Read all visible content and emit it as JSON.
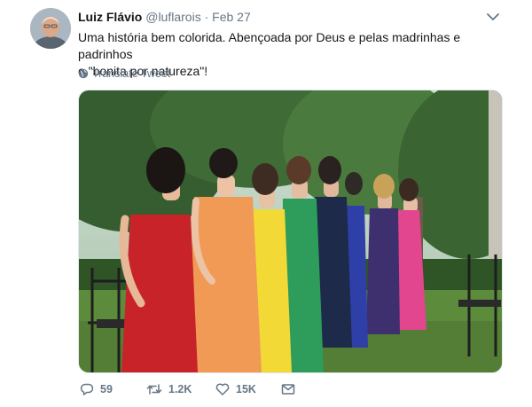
{
  "tweet": {
    "author_name": "Luiz Flávio",
    "handle": "@luflarois",
    "separator": "·",
    "date": "Feb 27",
    "text_line1": "Uma história bem colorida. Abençoada por Deus e pelas madrinhas e padrinhos",
    "text_line2": "e \"bonita por natureza\"!",
    "translate_label": "Translate Tweet",
    "replies": "59",
    "retweets": "1.2K",
    "likes": "15K"
  },
  "icons": {
    "avatar": "avatar",
    "caret": "chevron-down-icon",
    "translate": "globe-icon",
    "reply": "reply-icon",
    "retweet": "retweet-icon",
    "like": "heart-icon",
    "message": "envelope-icon"
  },
  "media": {
    "description_colors": [
      "#c9232a",
      "#f09a55",
      "#f2d936",
      "#2e9c5a",
      "#1d2a4a",
      "#2e3fa8",
      "#3e2f6e",
      "#e2468e"
    ]
  },
  "colors": {
    "text": "#14171a",
    "muted": "#657786",
    "border": "#e1e8ed"
  }
}
